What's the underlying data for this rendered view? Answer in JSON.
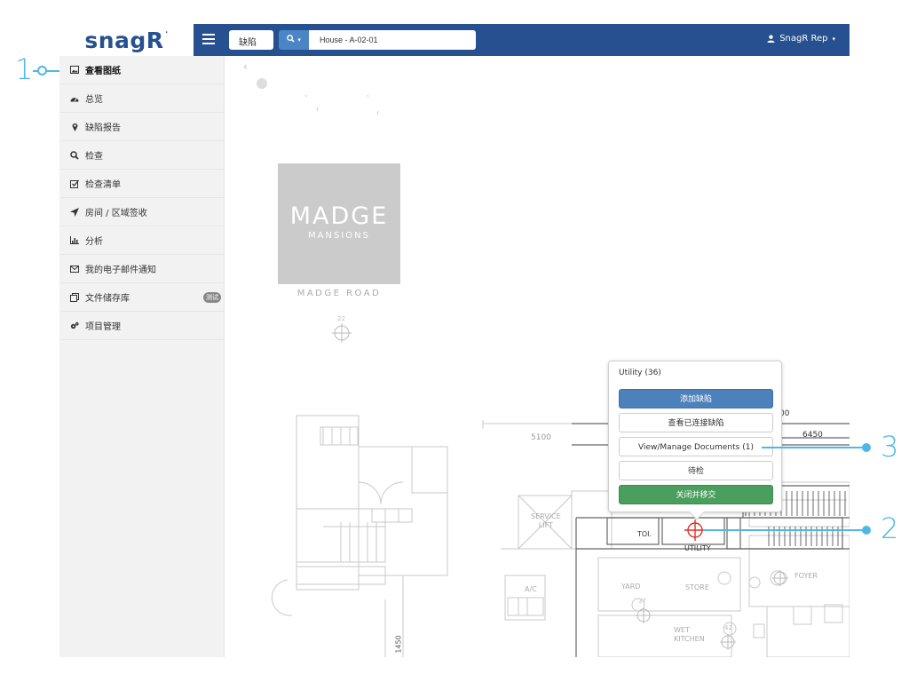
{
  "brand": {
    "logo_text": "snagR"
  },
  "topbar": {
    "search_type": "缺陷",
    "search_button_label": "Q",
    "search_value": "House - A-02-01",
    "user_label": "SnagR Rep"
  },
  "sidebar": {
    "items": [
      {
        "label": "查看图纸",
        "icon": "image-icon"
      },
      {
        "label": "总览",
        "icon": "dashboard-icon"
      },
      {
        "label": "缺陷报告",
        "icon": "map-pin-icon"
      },
      {
        "label": "检查",
        "icon": "search-icon"
      },
      {
        "label": "检查清单",
        "icon": "checklist-icon"
      },
      {
        "label": "房间 / 区域签收",
        "icon": "location-arrow-icon"
      },
      {
        "label": "分析",
        "icon": "bar-chart-icon"
      },
      {
        "label": "我的电子邮件通知",
        "icon": "envelope-icon"
      },
      {
        "label": "文件储存库",
        "icon": "copy-icon",
        "badge": "测试"
      },
      {
        "label": "项目管理",
        "icon": "cogs-icon"
      }
    ]
  },
  "drawing": {
    "logo_big": "MADGE",
    "logo_small": "MANSIONS",
    "road_label": "MADGE ROAD",
    "dimension_1": "5100",
    "dimension_2": "6450",
    "dimension_3": "00",
    "marker_22": "22",
    "marker_37": "37",
    "marker_42": "42",
    "room_service_lift_1": "SERVICE",
    "room_service_lift_2": "LIFT",
    "room_toi": "TOI.",
    "room_utility": "UTILITY",
    "room_yard": "YARD",
    "room_store": "STORE",
    "room_foyer": "FOYER",
    "room_ac": "A/C",
    "room_wet_kitchen_1": "WET",
    "room_wet_kitchen_2": "KITCHEN",
    "vertical_label": "1450"
  },
  "popup": {
    "title": "Utility (36)",
    "add_defect": "添加缺陷",
    "view_linked": "查看已连接缺陷",
    "manage_docs": "View/Manage Documents (1)",
    "pending": "待检",
    "close_move": "关闭并移交"
  },
  "callouts": {
    "one": "1",
    "two": "2",
    "three": "3"
  },
  "colors": {
    "brand": "#26508f",
    "callout": "#4fb7e8",
    "primary": "#4d81bc",
    "success": "#4a9e5e",
    "marker_red": "#d9342b"
  }
}
